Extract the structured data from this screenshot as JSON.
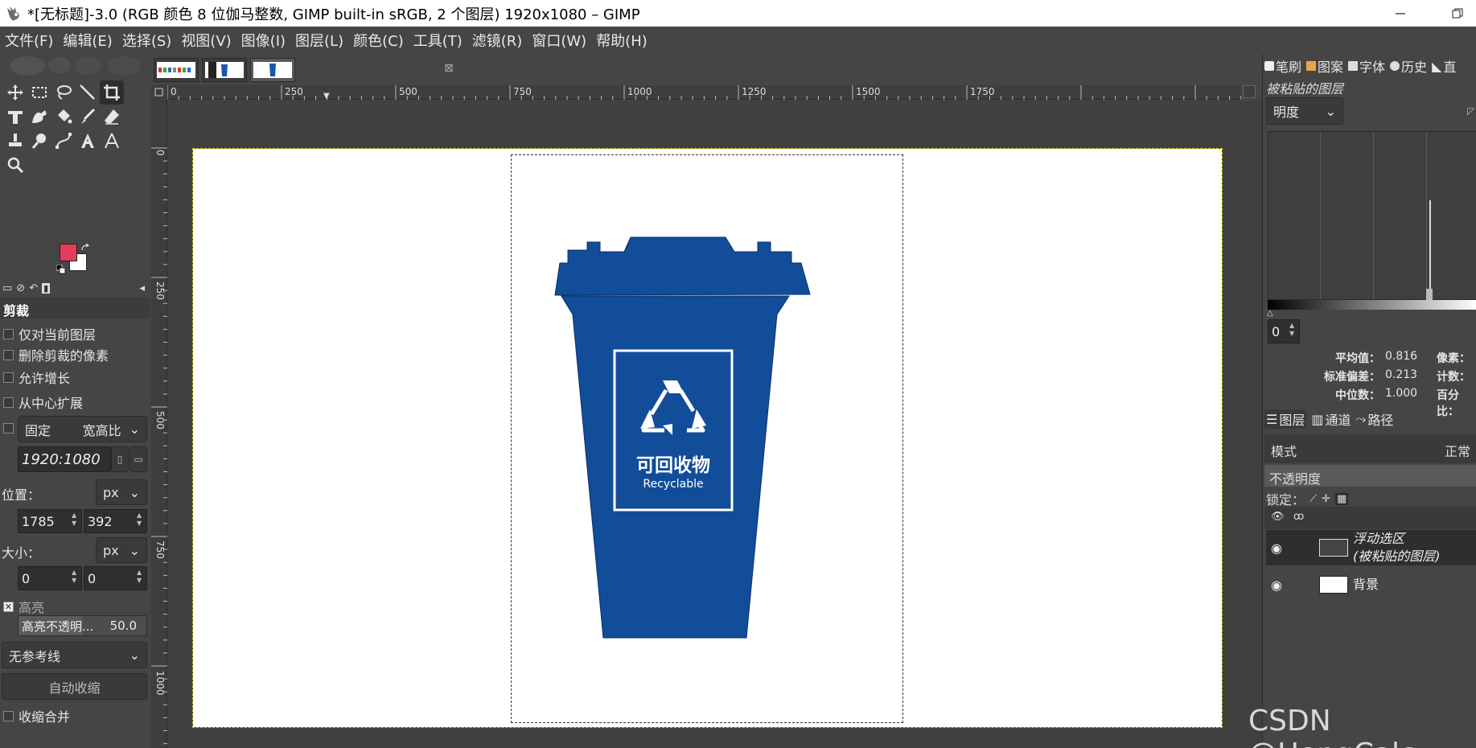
{
  "window": {
    "title": "*[无标题]-3.0 (RGB 颜色 8 位伽马整数, GIMP built-in sRGB, 2 个图层) 1920x1080 – GIMP"
  },
  "menu": [
    "文件(F)",
    "编辑(E)",
    "选择(S)",
    "视图(V)",
    "图像(I)",
    "图层(L)",
    "颜色(C)",
    "工具(T)",
    "滤镜(R)",
    "窗口(W)",
    "帮助(H)"
  ],
  "tool_options": {
    "title": "剪裁",
    "only_current_layer": "仅对当前图层",
    "delete_cropped": "删除剪裁的像素",
    "allow_growing": "允许增长",
    "expand_from_center": "从中心扩展",
    "fixed": "固定",
    "fixed_mode": "宽高比",
    "ratio_value": "1920:1080",
    "position_label": "位置：",
    "position_unit": "px",
    "position_x": "1785",
    "position_y": "392",
    "size_label": "大小：",
    "size_unit": "px",
    "size_w": "0",
    "size_h": "0",
    "highlight": "高亮",
    "highlight_opacity_label": "高亮不透明...",
    "highlight_opacity_value": "50.0",
    "highlight_opacity_fraction": 0.5,
    "guides": "无参考线",
    "auto_shrink": "自动收缩",
    "shrink_merged": "收缩合并"
  },
  "colors": {
    "foreground": "#e43d5b",
    "background": "#ffffff"
  },
  "rulers": {
    "horizontal": [
      "0",
      "250",
      "500",
      "750",
      "1000",
      "1250",
      "1500",
      "1750"
    ],
    "vertical": [
      "0",
      "250",
      "500",
      "750",
      "1000"
    ]
  },
  "canvas_image": {
    "bin_text_cn": "可回收物",
    "bin_text_en": "Recyclable",
    "bin_color": "#114d99"
  },
  "dock": {
    "top_tabs": [
      "笔刷",
      "图案",
      "字体",
      "历史",
      "直"
    ],
    "histogram_subtitle": "被粘贴的图层",
    "channel": "明度",
    "range_start": "0",
    "stats": {
      "mean_label": "平均值：",
      "mean": "0.816",
      "std_label": "标准偏差：",
      "std": "0.213",
      "median_label": "中位数：",
      "median": "1.000",
      "pixels_label": "像素：",
      "count_label": "计数：",
      "percentile_label": "百分比："
    },
    "layer_tabs": [
      "图层",
      "通道",
      "路径"
    ],
    "mode_label": "模式",
    "mode_value": "正常",
    "opacity_label": "不透明度",
    "lock_label": "锁定：",
    "layers": [
      {
        "name_line1": "浮动选区",
        "name_line2": "(被粘贴的图层)"
      },
      {
        "name_line1": "背景"
      }
    ]
  },
  "watermark": "CSDN @HongCalc"
}
